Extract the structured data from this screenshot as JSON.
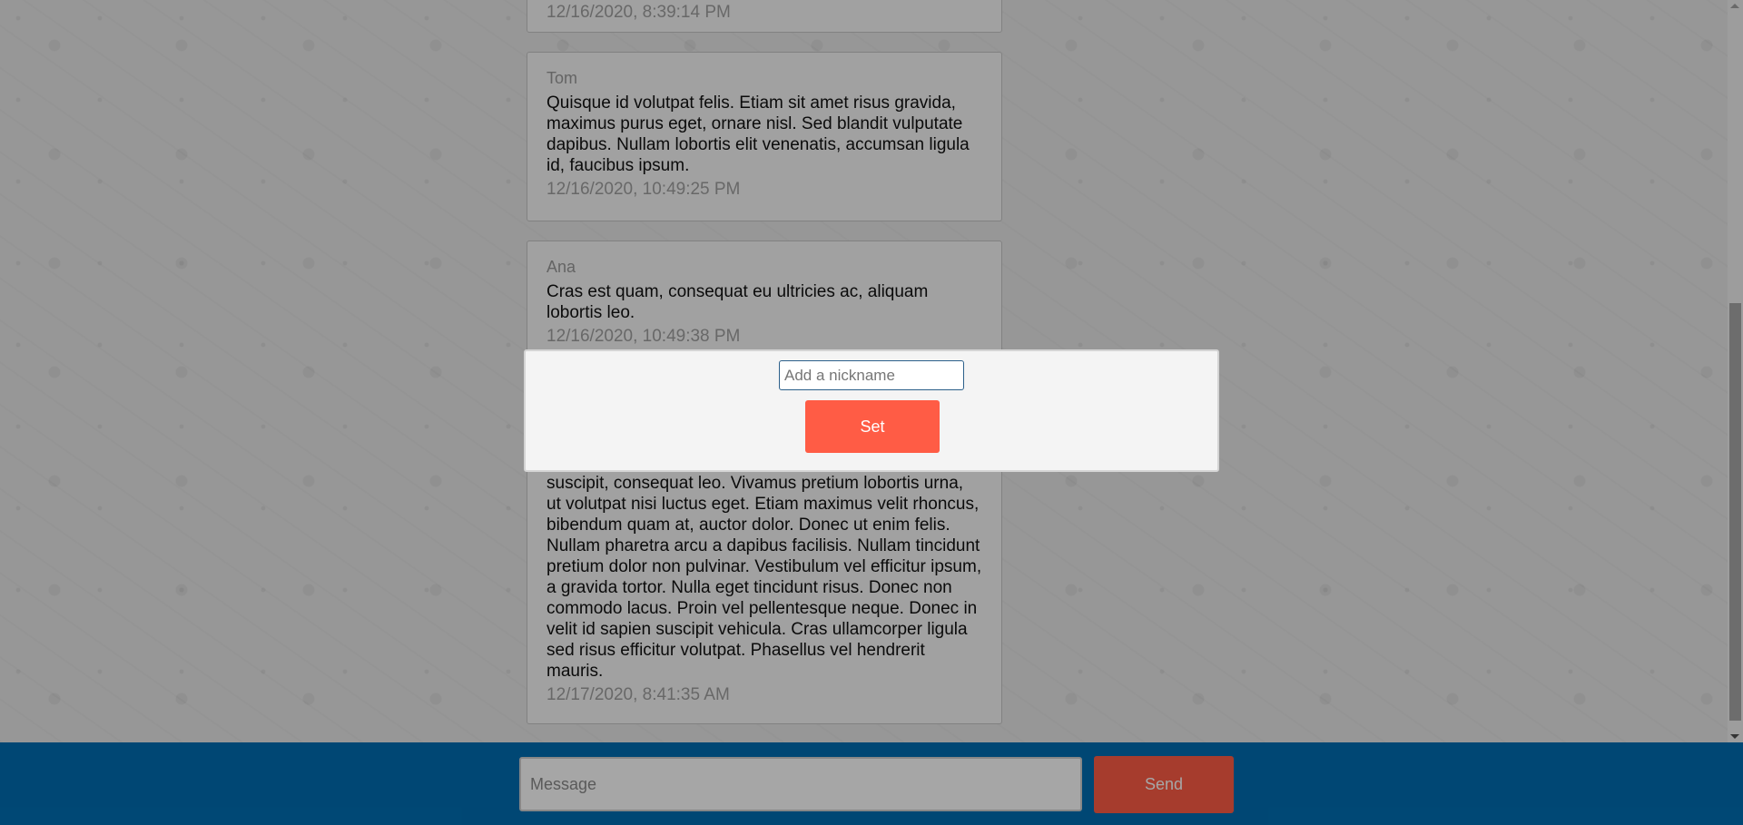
{
  "messages": [
    {
      "author": "",
      "text": "",
      "time": "12/16/2020, 8:39:14 PM"
    },
    {
      "author": "Tom",
      "text": "Quisque id volutpat felis. Etiam sit amet risus gravida, maximus purus eget, ornare nisl. Sed blandit vulputate dapibus. Nullam lobortis elit venenatis, accumsan ligula id, faucibus ipsum.",
      "time": "12/16/2020, 10:49:25 PM"
    },
    {
      "author": "Ana",
      "text": "Cras est quam, consequat eu ultricies ac, aliquam lobortis leo.",
      "time": "12/16/2020, 10:49:38 PM"
    },
    {
      "author": "",
      "text": "suscipit, consequat leo. Vivamus pretium lobortis urna, ut volutpat nisi luctus eget. Etiam maximus velit rhoncus, bibendum quam at, auctor dolor. Donec ut enim felis. Nullam pharetra arcu a dapibus facilisis. Nullam tincidunt pretium dolor non pulvinar. Vestibulum vel efficitur ipsum, a gravida tortor. Nulla eget tincidunt risus. Donec non commodo lacus. Proin vel pellentesque neque. Donec in velit id sapien suscipit vehicula. Cras ullamcorper ligula sed risus efficitur volutpat. Phasellus vel hendrerit mauris.",
      "time": "12/17/2020, 8:41:35 AM"
    }
  ],
  "composer": {
    "placeholder": "Message",
    "send_label": "Send"
  },
  "nickname_modal": {
    "placeholder": "Add a nickname",
    "set_label": "Set"
  },
  "colors": {
    "accent": "#ff5c45",
    "footer": "#006eb3"
  }
}
